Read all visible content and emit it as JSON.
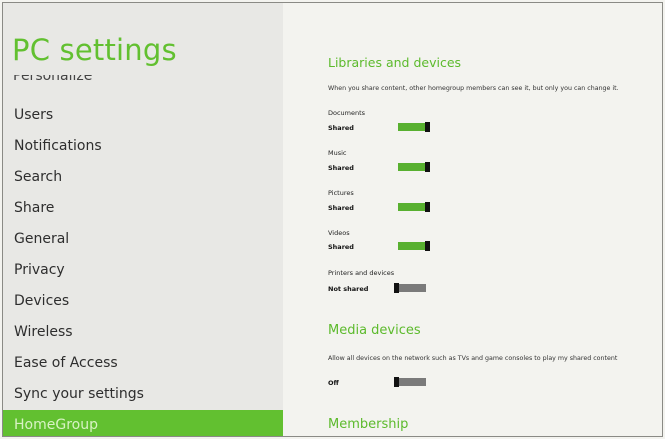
{
  "app": {
    "title": "PC settings"
  },
  "sidebar": {
    "partial_item": "Personalize",
    "items": [
      {
        "label": "Users"
      },
      {
        "label": "Notifications"
      },
      {
        "label": "Search"
      },
      {
        "label": "Share"
      },
      {
        "label": "General"
      },
      {
        "label": "Privacy"
      },
      {
        "label": "Devices"
      },
      {
        "label": "Wireless"
      },
      {
        "label": "Ease of Access"
      },
      {
        "label": "Sync your settings"
      },
      {
        "label": "HomeGroup",
        "selected": true
      }
    ]
  },
  "libraries": {
    "title": "Libraries and devices",
    "description": "When you share content, other homegroup members can see it, but only you can change it.",
    "items": [
      {
        "label": "Documents",
        "state": "Shared",
        "on": true
      },
      {
        "label": "Music",
        "state": "Shared",
        "on": true
      },
      {
        "label": "Pictures",
        "state": "Shared",
        "on": true
      },
      {
        "label": "Videos",
        "state": "Shared",
        "on": true
      },
      {
        "label": "Printers and devices",
        "state": "Not shared",
        "on": false
      }
    ]
  },
  "media": {
    "title": "Media devices",
    "description": "Allow all devices on the network such as TVs and game consoles to play my shared content",
    "state": "Off",
    "on": false
  },
  "membership": {
    "title": "Membership"
  },
  "colors": {
    "accent": "#62c030",
    "toggle_on": "#58b030",
    "toggle_off": "#7a7a7a",
    "thumb": "#111111"
  }
}
